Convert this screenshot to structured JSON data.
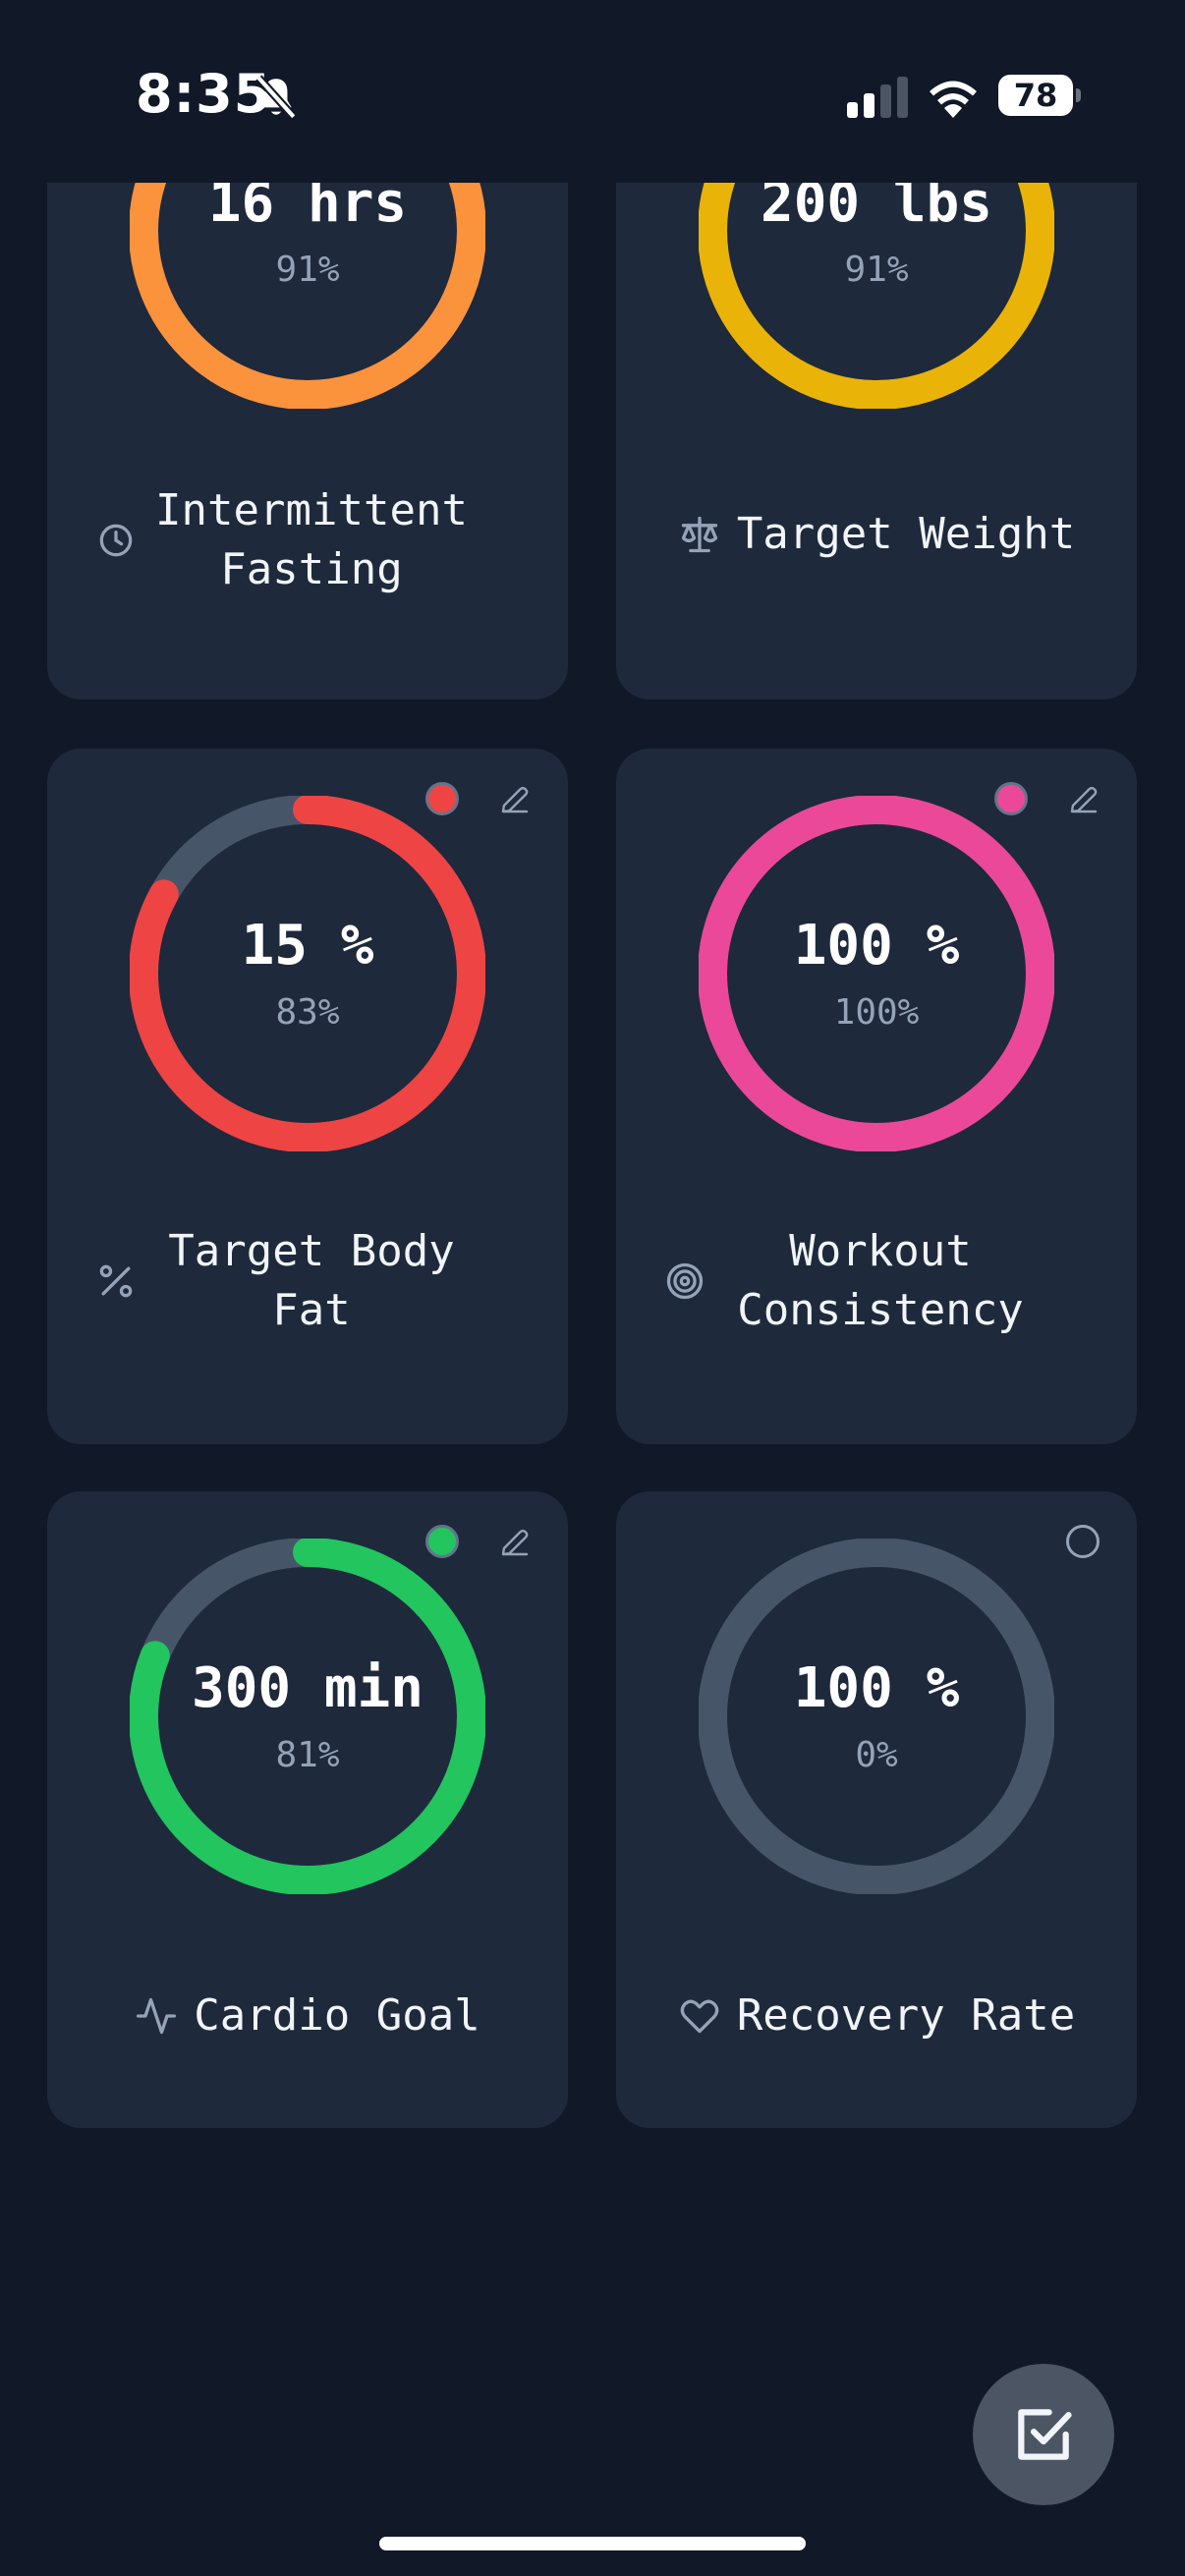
{
  "status_bar": {
    "time": "8:35",
    "battery": "78",
    "icons": [
      "bell-slash-icon",
      "cellular-signal-icon",
      "wifi-icon",
      "battery-icon"
    ]
  },
  "colors": {
    "background": "#111827",
    "card": "#1e293b",
    "track": "#475569",
    "orange": "#fb923c",
    "yellow": "#eab308",
    "red": "#ef4444",
    "pink": "#ec4899",
    "green": "#22c55e"
  },
  "goals": [
    {
      "value": "16 hrs",
      "percent_text": "91%",
      "progress": 0.91,
      "color": "#fb923c",
      "label": "Intermittent\nFasting",
      "icon": "clock-icon"
    },
    {
      "value": "200 lbs",
      "percent_text": "91%",
      "progress": 0.91,
      "color": "#eab308",
      "label": "Target Weight",
      "icon": "scale-icon"
    },
    {
      "value": "15 %",
      "percent_text": "83%",
      "progress": 0.83,
      "color": "#ef4444",
      "label": "Target Body\nFat",
      "icon": "percent-icon",
      "dot_color": "#ef4444",
      "editable": true
    },
    {
      "value": "100 %",
      "percent_text": "100%",
      "progress": 1.0,
      "color": "#ec4899",
      "label": "Workout\nConsistency",
      "icon": "target-icon",
      "dot_color": "#ec4899",
      "editable": true
    },
    {
      "value": "300 min",
      "percent_text": "81%",
      "progress": 0.81,
      "color": "#22c55e",
      "label": "Cardio Goal",
      "icon": "activity-icon",
      "dot_color": "#22c55e",
      "editable": true
    },
    {
      "value": "100 %",
      "percent_text": "0%",
      "progress": 0,
      "color": "#475569",
      "label": "Recovery Rate",
      "icon": "heart-icon",
      "dot_color": "",
      "editable": false
    }
  ],
  "fab": {
    "icon": "checkbox-icon"
  }
}
